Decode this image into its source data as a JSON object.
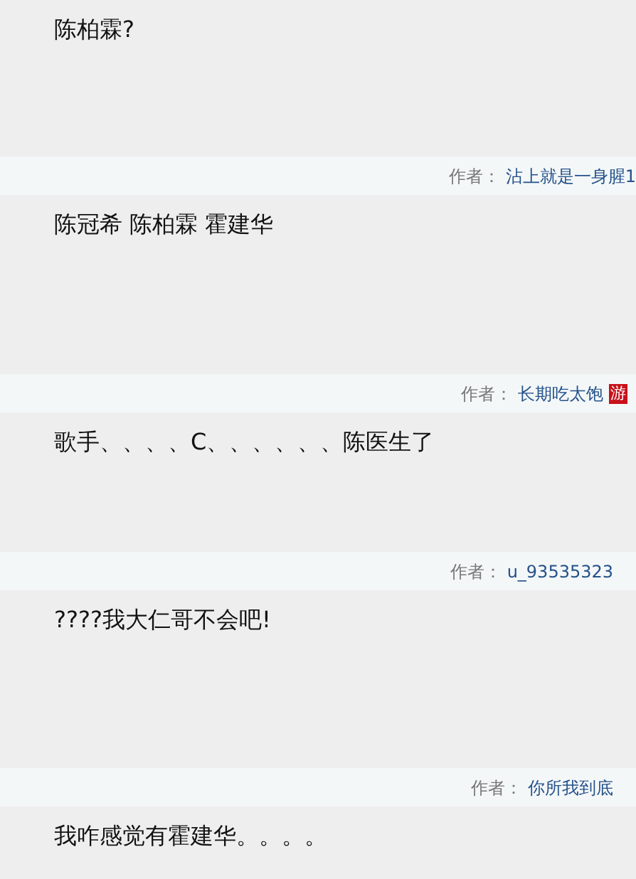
{
  "posts": [
    {
      "body": "陈柏霖?"
    },
    {
      "author_label": "作者：",
      "author": "沾上就是一身腥1",
      "body": "陈冠希 陈柏霖 霍建华"
    },
    {
      "author_label": "作者：",
      "author": "长期吃太饱",
      "badge": "游",
      "body": "歌手、、、、C、、、、、、陈医生了"
    },
    {
      "author_label": "作者：",
      "author": "u_93535323",
      "body": "????我大仁哥不会吧!"
    },
    {
      "author_label": "作者：",
      "author": "你所我到底",
      "body": "我咋感觉有霍建华。。。。"
    }
  ]
}
